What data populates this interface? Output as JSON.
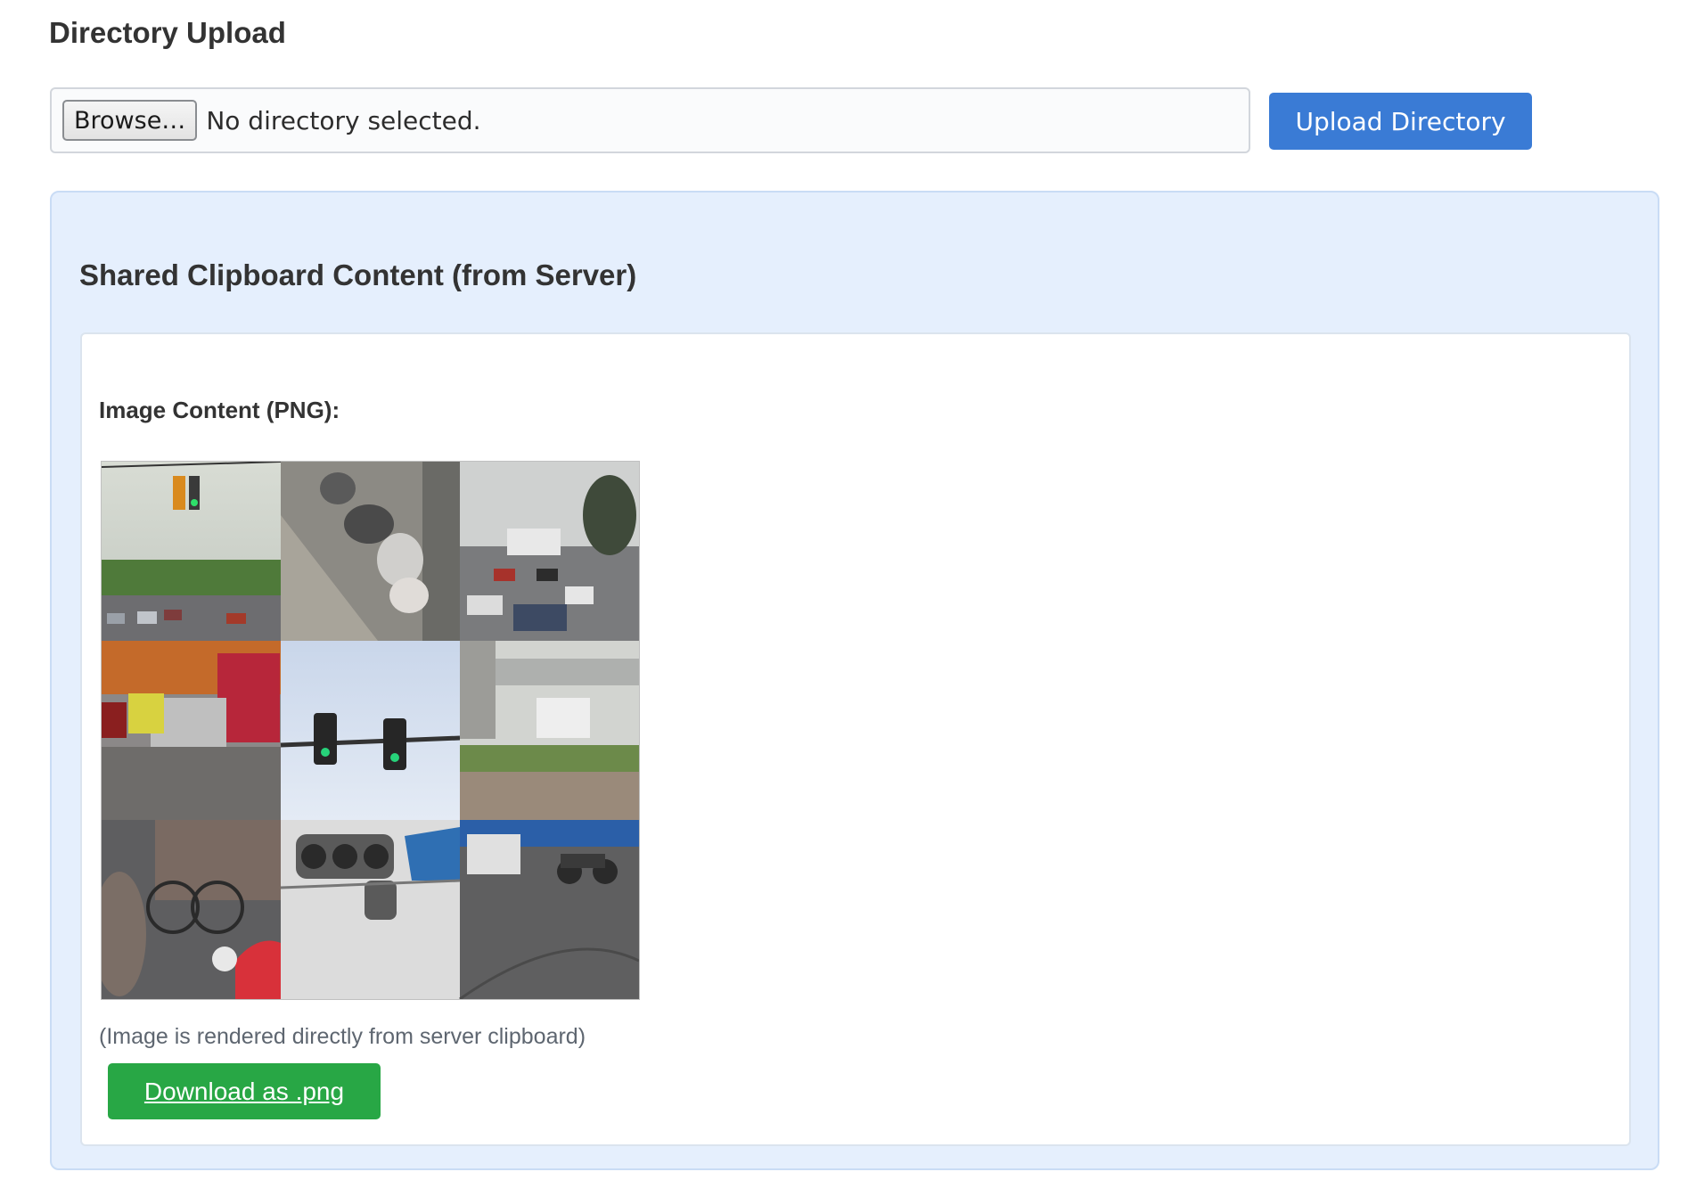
{
  "directory_upload": {
    "title": "Directory Upload",
    "browse_label": "Browse…",
    "file_status": "No directory selected.",
    "upload_label": "Upload Directory"
  },
  "clipboard": {
    "title": "Shared Clipboard Content (from Server)",
    "image_label": "Image Content (PNG):",
    "image_alt": "",
    "note": "(Image is rendered directly from server clipboard)",
    "download_label": "Download as .png",
    "tile_scenes": [
      "traffic-light-street",
      "parked-scooters",
      "street-traffic",
      "parked-cars-shops",
      "traffic-lights-sky",
      "overpass-field",
      "bicycle-car",
      "traffic-light-sign",
      "cars-motorbike"
    ]
  },
  "colors": {
    "primary": "#3a7bd5",
    "success": "#28a745",
    "panel_bg": "#e5effd"
  }
}
